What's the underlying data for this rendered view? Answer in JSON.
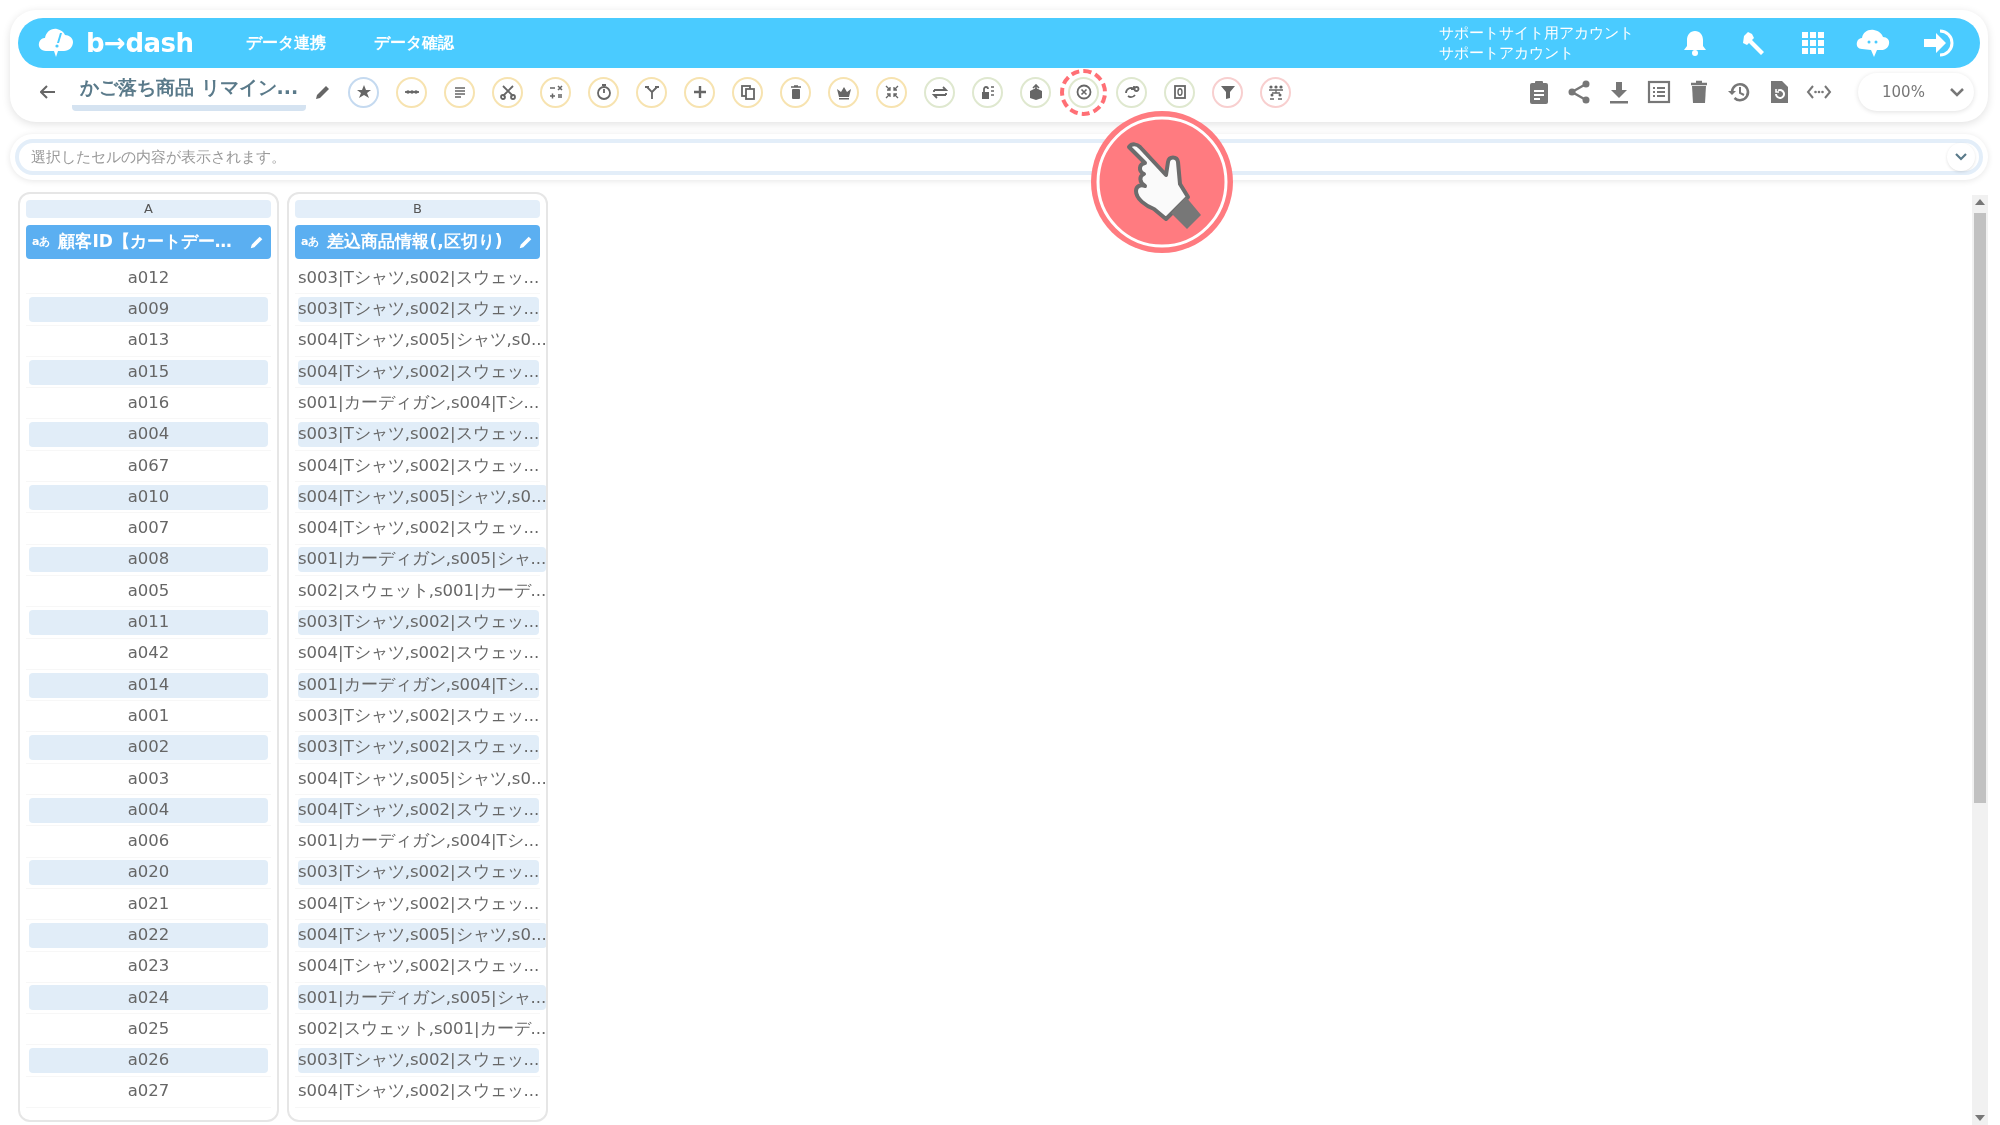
{
  "header": {
    "brand": "b→dash",
    "nav": [
      {
        "label": "データ連携"
      },
      {
        "label": "データ確認"
      }
    ],
    "account": {
      "line_1": "サポートサイト用アカウント",
      "line_2": "サポートアカウント"
    }
  },
  "toolbar": {
    "title": "かご落ち商品 リマイン...",
    "tools": [
      {
        "color": "#c5daf0",
        "highlighted": false
      },
      {
        "color": "#f7e3b0",
        "highlighted": false
      },
      {
        "color": "#f7e3b0",
        "highlighted": false
      },
      {
        "color": "#f7e3b0",
        "highlighted": false
      },
      {
        "color": "#f7e3b0",
        "highlighted": false
      },
      {
        "color": "#f7e3b0",
        "highlighted": false
      },
      {
        "color": "#f7e3b0",
        "highlighted": false
      },
      {
        "color": "#f7e3b0",
        "highlighted": false
      },
      {
        "color": "#f7e3b0",
        "highlighted": false
      },
      {
        "color": "#f7e3b0",
        "highlighted": false
      },
      {
        "color": "#f7e3b0",
        "highlighted": false
      },
      {
        "color": "#f7e3b0",
        "highlighted": false
      },
      {
        "color": "#dfe8cf",
        "highlighted": false
      },
      {
        "color": "#dfe8cf",
        "highlighted": false
      },
      {
        "color": "#dfe8cf",
        "highlighted": false
      },
      {
        "color": "#dfe8cf",
        "highlighted": true
      },
      {
        "color": "#dfe8cf",
        "highlighted": false
      },
      {
        "color": "#dfe8cf",
        "highlighted": false
      },
      {
        "color": "#f8cfcf",
        "highlighted": false
      },
      {
        "color": "#f8cfcf",
        "highlighted": false
      }
    ],
    "zoom": "100%"
  },
  "formula_bar": {
    "placeholder": "選択したセルの内容が表示されます。"
  },
  "columns": [
    {
      "letter": "A",
      "type_badge": "aあ",
      "name": "顧客ID【カートデー…",
      "cells": [
        "a012",
        "a009",
        "a013",
        "a015",
        "a016",
        "a004",
        "a067",
        "a010",
        "a007",
        "a008",
        "a005",
        "a011",
        "a042",
        "a014",
        "a001",
        "a002",
        "a003",
        "a004",
        "a006",
        "a020",
        "a021",
        "a022",
        "a023",
        "a024",
        "a025",
        "a026",
        "a027"
      ]
    },
    {
      "letter": "B",
      "type_badge": "aあ",
      "name": "差込商品情報(,区切り)",
      "cells": [
        "s003|Tシャツ,s002|スウェッ...",
        "s003|Tシャツ,s002|スウェッ...",
        "s004|Tシャツ,s005|シャツ,s0...",
        "s004|Tシャツ,s002|スウェッ...",
        "s001|カーディガン,s004|Tシ...",
        "s003|Tシャツ,s002|スウェッ...",
        "s004|Tシャツ,s002|スウェッ...",
        "s004|Tシャツ,s005|シャツ,s0...",
        "s004|Tシャツ,s002|スウェッ...",
        "s001|カーディガン,s005|シャ...",
        "s002|スウェット,s001|カーデ...",
        "s003|Tシャツ,s002|スウェッ...",
        "s004|Tシャツ,s002|スウェッ...",
        "s001|カーディガン,s004|Tシ...",
        "s003|Tシャツ,s002|スウェッ...",
        "s003|Tシャツ,s002|スウェッ...",
        "s004|Tシャツ,s005|シャツ,s0...",
        "s004|Tシャツ,s002|スウェッ...",
        "s001|カーディガン,s004|Tシ...",
        "s003|Tシャツ,s002|スウェッ...",
        "s004|Tシャツ,s002|スウェッ...",
        "s004|Tシャツ,s005|シャツ,s0...",
        "s004|Tシャツ,s002|スウェッ...",
        "s001|カーディガン,s005|シャ...",
        "s002|スウェット,s001|カーデ...",
        "s003|Tシャツ,s002|スウェッ...",
        "s004|Tシャツ,s002|スウェッ..."
      ]
    }
  ]
}
